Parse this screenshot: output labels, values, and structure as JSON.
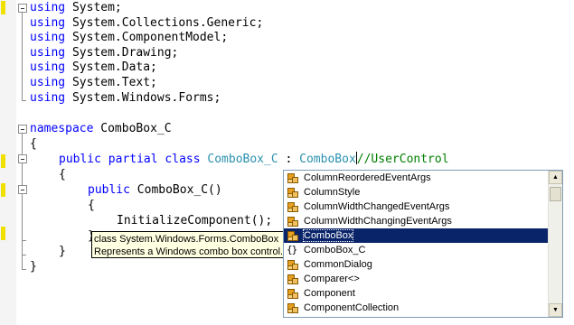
{
  "code": {
    "using_lines": [
      {
        "kw": "using",
        "rest": " System;"
      },
      {
        "kw": "using",
        "rest": " System.Collections.Generic;"
      },
      {
        "kw": "using",
        "rest": " System.ComponentModel;"
      },
      {
        "kw": "using",
        "rest": " System.Drawing;"
      },
      {
        "kw": "using",
        "rest": " System.Data;"
      },
      {
        "kw": "using",
        "rest": " System.Text;"
      },
      {
        "kw": "using",
        "rest": " System.Windows.Forms;"
      }
    ],
    "namespace_kw": "namespace",
    "namespace_name": " ComboBox_C",
    "open_brace": "{",
    "class_kw1": "public",
    "class_kw2": "partial",
    "class_kw3": "class",
    "class_name": "ComboBox_C",
    "class_colon": " : ",
    "class_base": "ComboBox",
    "class_comment": "//UserControl",
    "class_open_brace": "{",
    "ctor_kw": "public",
    "ctor_name": " ComboBox_C()",
    "ctor_open_brace": "{",
    "ctor_body": "InitializeComponent();",
    "ctor_close_brace": "}",
    "class_close_brace": "}",
    "ns_close_brace": "}"
  },
  "tooltip": {
    "line1": "class System.Windows.Forms.ComboBox",
    "line2": "Represents a Windows combo box control."
  },
  "completion": {
    "items": [
      {
        "label": "ColumnReorderedEventArgs",
        "icon": "class-icon"
      },
      {
        "label": "ColumnStyle",
        "icon": "class-icon"
      },
      {
        "label": "ColumnWidthChangedEventArgs",
        "icon": "class-icon"
      },
      {
        "label": "ColumnWidthChangingEventArgs",
        "icon": "class-icon"
      },
      {
        "label": "ComboBox",
        "icon": "class-icon",
        "selected": true
      },
      {
        "label": "ComboBox_C",
        "icon": "namespace-icon"
      },
      {
        "label": "CommonDialog",
        "icon": "class-icon"
      },
      {
        "label": "Comparer<>",
        "icon": "class-icon"
      },
      {
        "label": "Component",
        "icon": "class-icon"
      },
      {
        "label": "ComponentCollection",
        "icon": "class-icon"
      }
    ],
    "namespace_glyph": "{}",
    "scroll_up_glyph": "▲",
    "scroll_down_glyph": "▼"
  },
  "colors": {
    "keyword": "#0000ff",
    "type": "#2b91af",
    "comment": "#008000",
    "selection": "#0a246a",
    "tooltip_bg": "#ffffe1"
  }
}
